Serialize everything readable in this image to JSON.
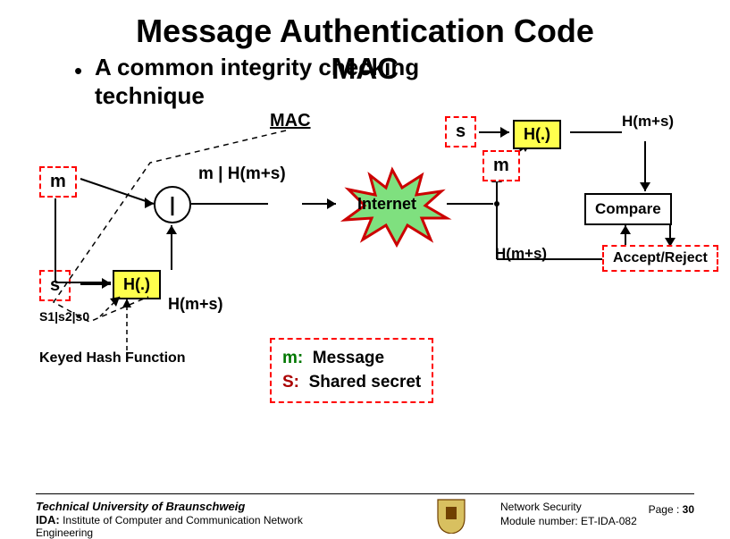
{
  "title_line1": "Message Authentication Code",
  "title_line2": "MAC",
  "bullet_char": "•",
  "bullet_line1": "A common integrity checking",
  "bullet_line2": "technique",
  "mac_label": "MAC",
  "sender": {
    "m": "m",
    "s": "s",
    "concat": "|",
    "hash": "H(.)",
    "hms_out": "H(m+s)",
    "seed": "S1|s2|s0",
    "khf": "Keyed Hash Function",
    "channel_msg": "m | H(m+s)"
  },
  "internet": "Internet",
  "receiver": {
    "s": "s",
    "m": "m",
    "hash": "H(.)",
    "hms_in": "H(m+s)",
    "hms_calc": "H(m+s)",
    "compare": "Compare",
    "verdict": "Accept/Reject"
  },
  "legend": {
    "m_key": "m:",
    "m_val": "Message",
    "s_key": "S:",
    "s_val": "Shared secret"
  },
  "footer": {
    "university": "Technical University of Braunschweig",
    "ida_bold": "IDA:",
    "ida_rest": "Institute of Computer and Communication Network Engineering",
    "course": "Network Security",
    "module": "Module number: ET-IDA-082",
    "page_label": "Page :",
    "page_num": "30"
  }
}
